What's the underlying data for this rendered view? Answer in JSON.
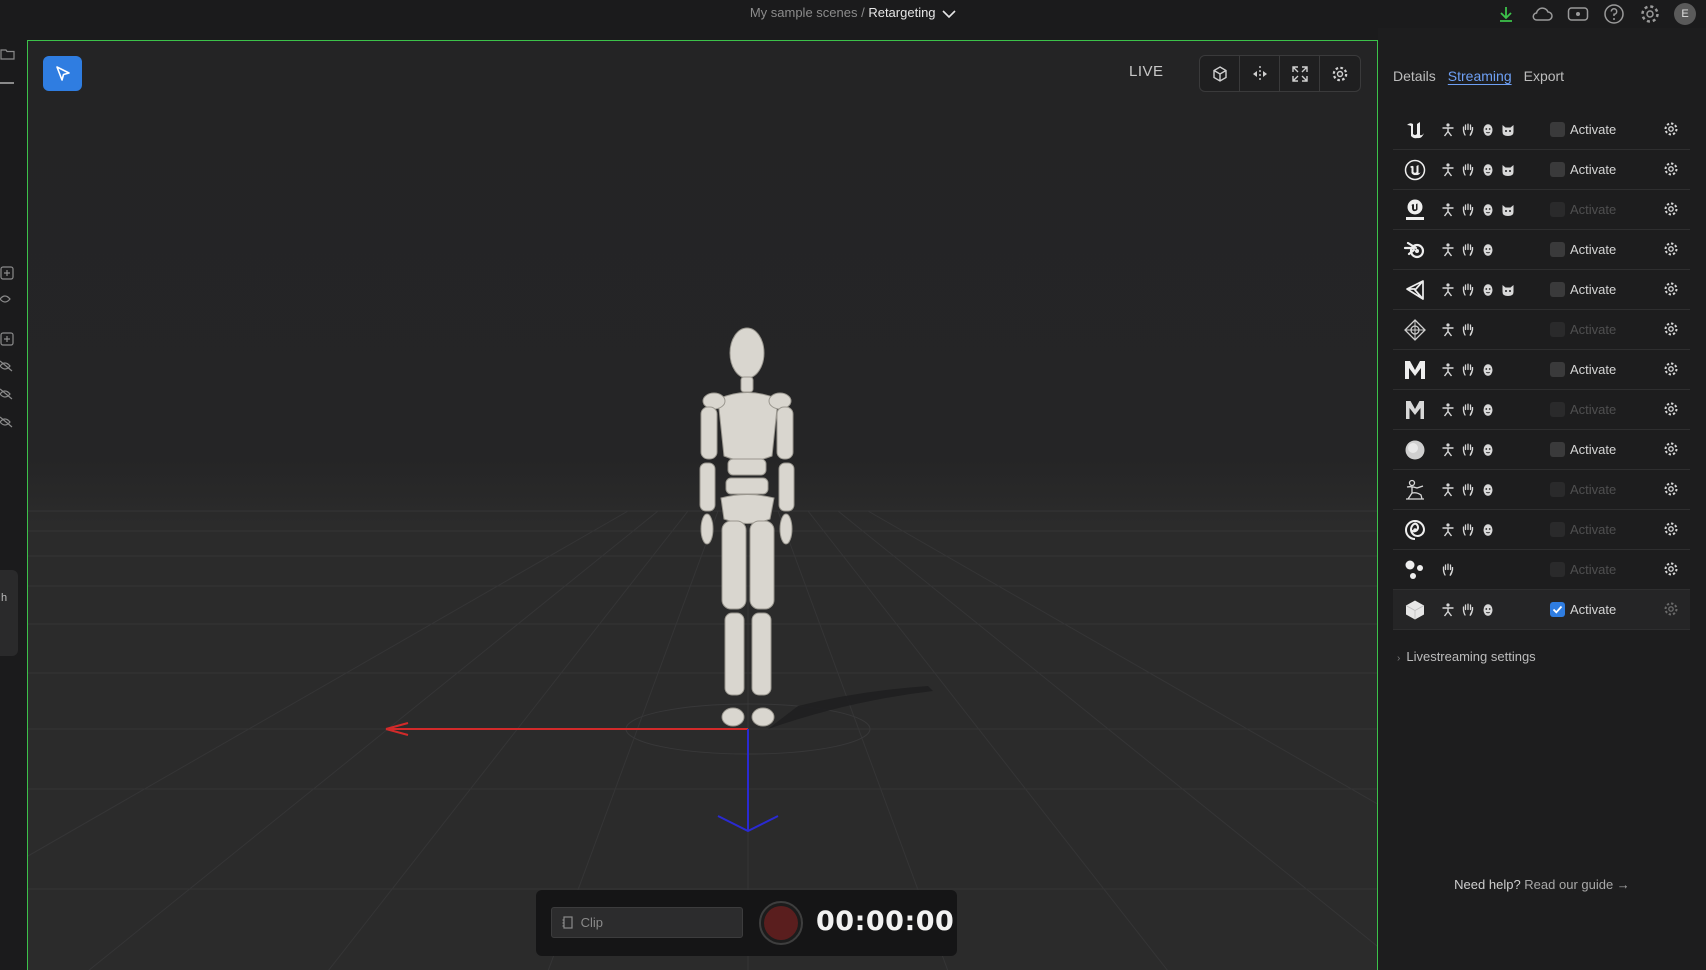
{
  "breadcrumb": {
    "parent": "My sample scenes /",
    "current": "Retargeting"
  },
  "viewport": {
    "live_label": "LIVE",
    "tools": [
      "cube-view-icon",
      "mirror-icon",
      "fullscreen-icon",
      "gear-icon"
    ]
  },
  "recorder": {
    "clip_placeholder": "Clip",
    "timer": "00:00:00"
  },
  "panel": {
    "tabs": [
      {
        "label": "Details",
        "active": false
      },
      {
        "label": "Streaming",
        "active": true
      },
      {
        "label": "Export",
        "active": false
      }
    ],
    "targets": [
      {
        "logo": "unreal-engine-logo",
        "caps": [
          "body",
          "hands",
          "face",
          "props"
        ],
        "activate": "Activate",
        "enabled": true,
        "checked": false
      },
      {
        "logo": "unreal-circle-logo",
        "caps": [
          "body",
          "hands",
          "face",
          "props"
        ],
        "activate": "Activate",
        "enabled": true,
        "checked": false
      },
      {
        "logo": "fortnite-logo",
        "caps": [
          "body",
          "hands",
          "face",
          "props"
        ],
        "activate": "Activate",
        "enabled": false,
        "checked": false
      },
      {
        "logo": "blender-logo",
        "caps": [
          "body",
          "hands",
          "face"
        ],
        "activate": "Activate",
        "enabled": true,
        "checked": false
      },
      {
        "logo": "unity-logo",
        "caps": [
          "body",
          "hands",
          "face",
          "props"
        ],
        "activate": "Activate",
        "enabled": true,
        "checked": false
      },
      {
        "logo": "omniverse-logo",
        "caps": [
          "body",
          "hands"
        ],
        "activate": "Activate",
        "enabled": false,
        "checked": false
      },
      {
        "logo": "maya-logo",
        "caps": [
          "body",
          "hands",
          "face"
        ],
        "activate": "Activate",
        "enabled": true,
        "checked": false
      },
      {
        "logo": "motionbuilder-logo",
        "caps": [
          "body",
          "hands",
          "face"
        ],
        "activate": "Activate",
        "enabled": false,
        "checked": false
      },
      {
        "logo": "sphere-logo",
        "caps": [
          "body",
          "hands",
          "face"
        ],
        "activate": "Activate",
        "enabled": true,
        "checked": false
      },
      {
        "logo": "character-logo",
        "caps": [
          "body",
          "hands",
          "face"
        ],
        "activate": "Activate",
        "enabled": false,
        "checked": false
      },
      {
        "logo": "houdini-logo",
        "caps": [
          "body",
          "hands",
          "face"
        ],
        "activate": "Activate",
        "enabled": false,
        "checked": false
      },
      {
        "logo": "dots-logo",
        "caps": [
          "hands"
        ],
        "activate": "Activate",
        "enabled": false,
        "checked": false
      },
      {
        "logo": "cube-logo",
        "caps": [
          "body",
          "hands",
          "face"
        ],
        "activate": "Activate",
        "enabled": true,
        "checked": true
      }
    ],
    "livestreaming_settings": "Livestreaming settings",
    "help": {
      "question": "Need help?",
      "link": "Read our guide →"
    }
  }
}
